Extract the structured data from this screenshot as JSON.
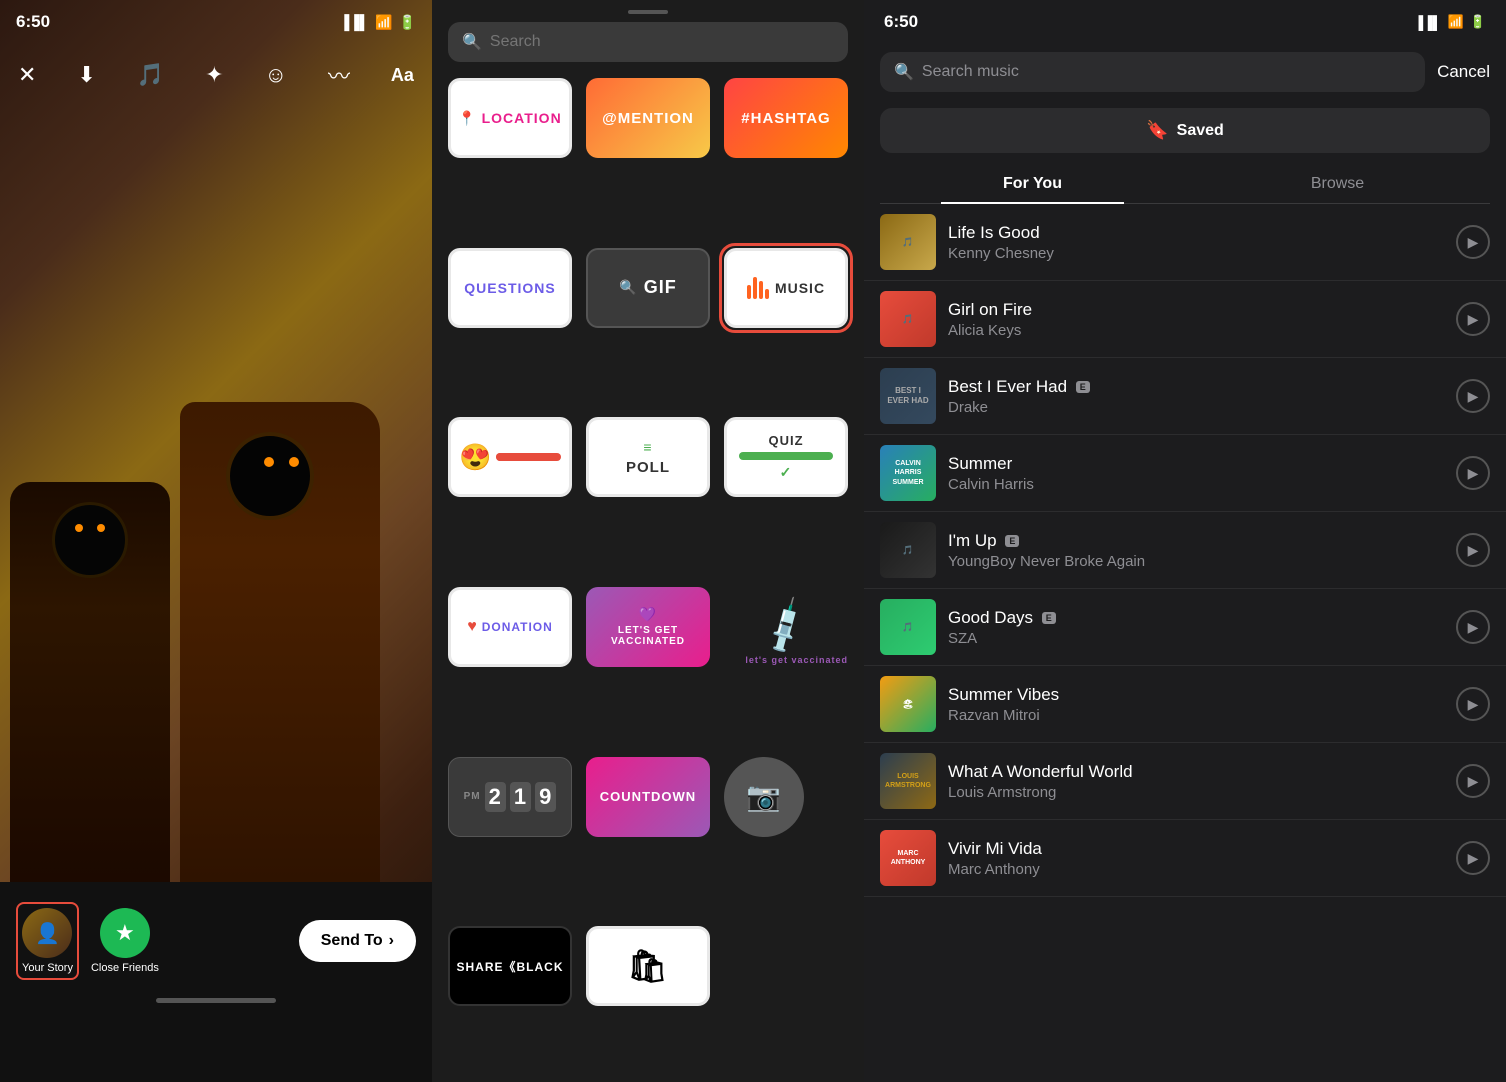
{
  "panel1": {
    "status_time": "6:50",
    "toolbar": {
      "close_icon": "✕",
      "download_icon": "⬇",
      "music_icon": "♪",
      "sparkle_icon": "✦",
      "face_icon": "☺",
      "squiggle_icon": "〜",
      "text_icon": "Aa"
    },
    "bottom": {
      "your_story_label": "Your Story",
      "close_friends_label": "Close Friends",
      "send_to_label": "Send To"
    }
  },
  "panel2": {
    "status_time": "6:50",
    "search_placeholder": "Search",
    "stickers": [
      {
        "id": "location",
        "label": "📍LOCATION",
        "type": "location"
      },
      {
        "id": "mention",
        "label": "@MENTION",
        "type": "mention"
      },
      {
        "id": "hashtag",
        "label": "#HASHTAG",
        "type": "hashtag"
      },
      {
        "id": "questions",
        "label": "QUESTIONS",
        "type": "questions"
      },
      {
        "id": "gif",
        "label": "GIF",
        "type": "gif"
      },
      {
        "id": "music",
        "label": "MUSIC",
        "type": "music"
      },
      {
        "id": "emoji-slider",
        "label": "emoji-slider",
        "type": "emoji"
      },
      {
        "id": "poll",
        "label": "POLL",
        "type": "poll"
      },
      {
        "id": "quiz",
        "label": "QUIZ",
        "type": "quiz"
      },
      {
        "id": "donation",
        "label": "DONATION",
        "type": "donation"
      },
      {
        "id": "vaccinated",
        "label": "LET'S GET VACCINATED",
        "type": "vaccinated"
      },
      {
        "id": "vax-sticker",
        "label": "let's get vaccinated",
        "type": "vax-sticker"
      },
      {
        "id": "countdown-timer",
        "label": "2 19",
        "type": "countdown-timer"
      },
      {
        "id": "countdown",
        "label": "COUNTDOWN",
        "type": "countdown"
      },
      {
        "id": "camera",
        "label": "camera",
        "type": "camera"
      },
      {
        "id": "share-black",
        "label": "SHARE BLACK",
        "type": "share"
      },
      {
        "id": "bag",
        "label": "bag",
        "type": "bag"
      }
    ]
  },
  "panel3": {
    "status_time": "6:50",
    "search_placeholder": "Search music",
    "cancel_label": "Cancel",
    "saved_label": "Saved",
    "tabs": [
      {
        "id": "for-you",
        "label": "For You",
        "active": true
      },
      {
        "id": "browse",
        "label": "Browse",
        "active": false
      }
    ],
    "songs": [
      {
        "id": 1,
        "title": "Life Is Good",
        "artist": "Kenny Chesney",
        "explicit": false,
        "thumb_class": "thumb-life"
      },
      {
        "id": 2,
        "title": "Girl on Fire",
        "artist": "Alicia Keys",
        "explicit": false,
        "thumb_class": "thumb-girl"
      },
      {
        "id": 3,
        "title": "Best I Ever Had",
        "artist": "Drake",
        "explicit": true,
        "thumb_class": "thumb-best"
      },
      {
        "id": 4,
        "title": "Summer",
        "artist": "Calvin Harris",
        "explicit": false,
        "thumb_class": "thumb-summer"
      },
      {
        "id": 5,
        "title": "I'm Up",
        "artist": "YoungBoy Never Broke Again",
        "explicit": true,
        "thumb_class": "thumb-imup"
      },
      {
        "id": 6,
        "title": "Good Days",
        "artist": "SZA",
        "explicit": true,
        "thumb_class": "thumb-good"
      },
      {
        "id": 7,
        "title": "Summer Vibes",
        "artist": "Razvan Mitroi",
        "explicit": false,
        "thumb_class": "thumb-vibes"
      },
      {
        "id": 8,
        "title": "What A Wonderful World",
        "artist": "Louis Armstrong",
        "explicit": false,
        "thumb_class": "thumb-wonderful"
      },
      {
        "id": 9,
        "title": "Vivir Mi Vida",
        "artist": "Marc Anthony",
        "explicit": false,
        "thumb_class": "thumb-vivir"
      }
    ]
  }
}
